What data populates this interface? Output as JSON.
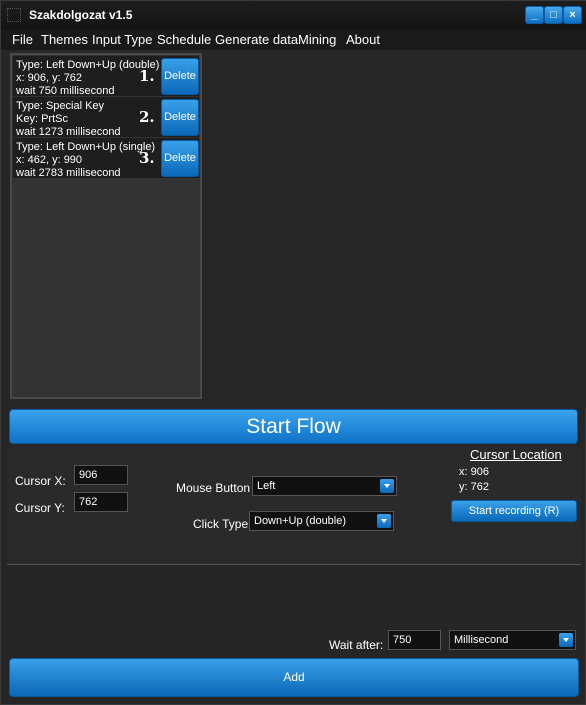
{
  "window": {
    "title": "Szakdolgozat v1.5",
    "minimize_label": "_",
    "maximize_label": "□",
    "close_label": "×"
  },
  "menu": [
    "File",
    "Themes",
    "Input Type",
    "Schedule",
    "Generate data",
    "Mining",
    "About"
  ],
  "flow_items": [
    {
      "line1": "Type: Left Down+Up (double)",
      "line2": "x: 906, y: 762",
      "line3": "wait 750 millisecond",
      "number": "1.",
      "delete_label": "Delete"
    },
    {
      "line1": "Type: Special Key",
      "line2": "Key: PrtSc",
      "line3": "wait 1273 millisecond",
      "number": "2.",
      "delete_label": "Delete"
    },
    {
      "line1": "Type: Left Down+Up (single)",
      "line2": "x: 462, y: 990",
      "line3": "wait 2783 millisecond",
      "number": "3.",
      "delete_label": "Delete"
    }
  ],
  "start_flow_label": "Start Flow",
  "config": {
    "cursor_x_label": "Cursor X:",
    "cursor_x_value": "906",
    "cursor_y_label": "Cursor Y:",
    "cursor_y_value": "762",
    "mouse_button_label": "Mouse Button",
    "mouse_button_value": "Left",
    "click_type_label": "Click Type",
    "click_type_value": "Down+Up (double)"
  },
  "cursor_location": {
    "title": "Cursor Location",
    "x_text": "x: 906",
    "y_text": "y: 762",
    "record_label": "Start recording (R)"
  },
  "wait": {
    "label": "Wait after:",
    "value": "750",
    "unit": "Millisecond"
  },
  "add_label": "Add",
  "colors": {
    "accent": "#1a86d9",
    "background": "#262626",
    "list_bg": "#333333"
  }
}
